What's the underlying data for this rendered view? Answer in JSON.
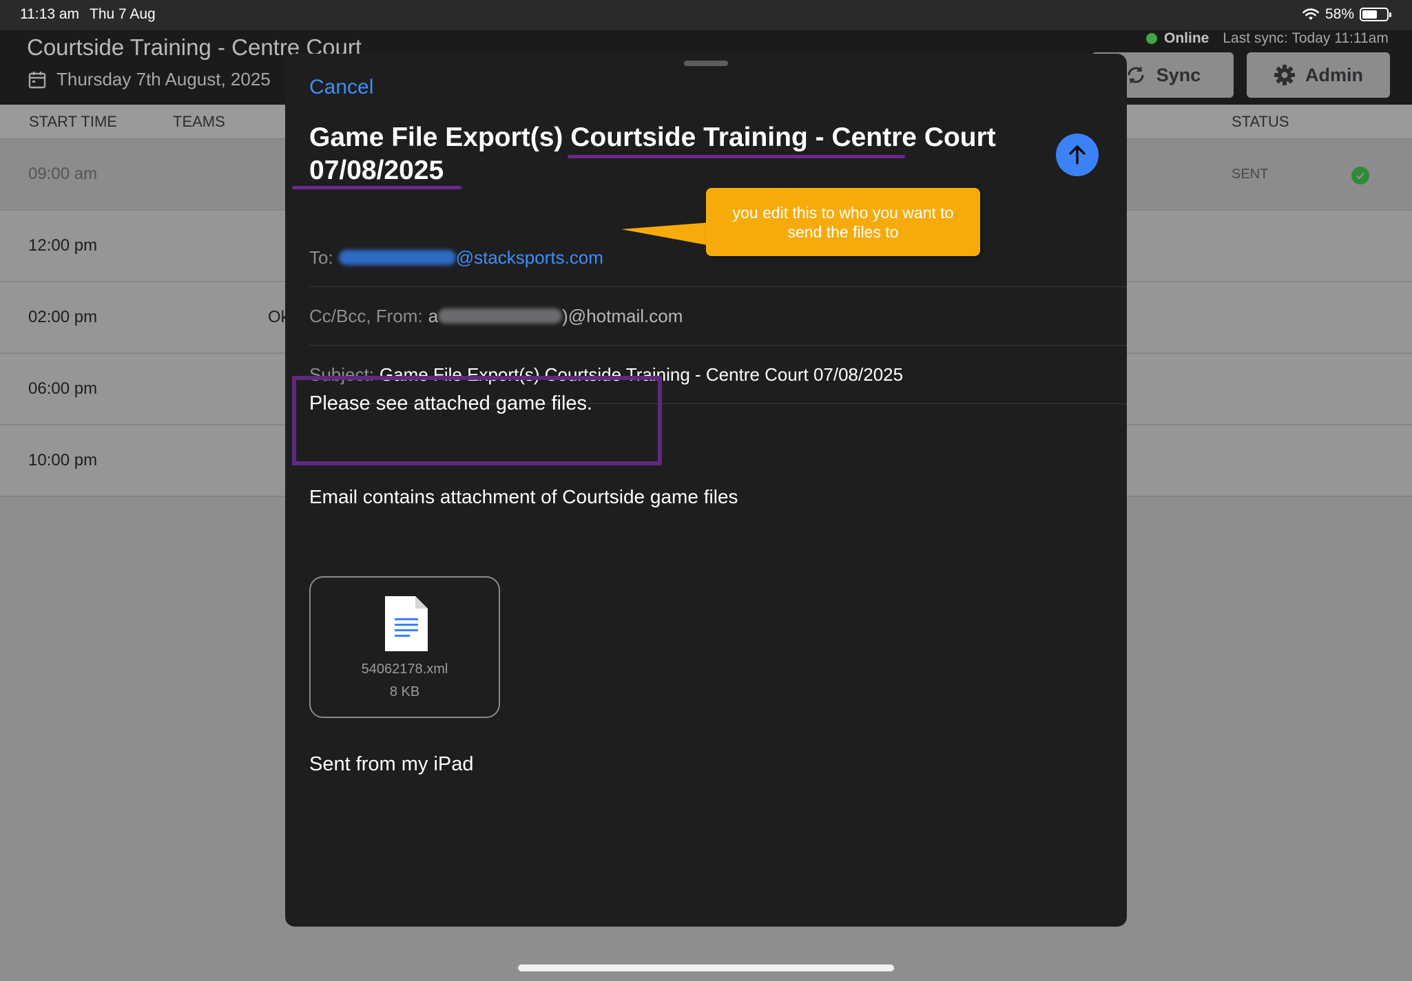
{
  "status_bar": {
    "time": "11:13 am",
    "date": "Thu 7 Aug",
    "battery": "58%"
  },
  "app": {
    "title": "Courtside Training - Centre Court",
    "date": "Thursday 7th August, 2025",
    "online_label": "Online",
    "last_sync": "Last sync: Today 11:11am",
    "sync_button": "Sync",
    "admin_button": "Admin"
  },
  "table": {
    "headers": [
      "START TIME",
      "TEAMS",
      "STATUS"
    ],
    "rows": [
      {
        "time": "09:00 am",
        "status": "SENT"
      },
      {
        "time": "12:00 pm"
      },
      {
        "time": "02:00 pm",
        "teams_partial": "Ok"
      },
      {
        "time": "06:00 pm"
      },
      {
        "time": "10:00 pm"
      }
    ]
  },
  "compose": {
    "cancel": "Cancel",
    "title_prefix": "Game File Export(s) ",
    "title_venue": "Courtside Training - Centre Court",
    "title_date": "07/08/2025",
    "to_label": "To:",
    "to_domain": "@stacksports.com",
    "cc_label": "Cc/Bcc, From:",
    "cc_initial": "a",
    "cc_domain": ")@hotmail.com",
    "subject_label": "Subject:",
    "subject_value": "Game File Export(s) Courtside Training - Centre Court  07/08/2025",
    "body": "Please see attached game files.",
    "attachment_note": "Email contains attachment of Courtside game files",
    "attachment": {
      "name": "54062178.xml",
      "size": "8 KB"
    },
    "signature": "Sent from my iPad"
  },
  "callout": {
    "text": "you edit this to who you want to send the files to"
  },
  "colors": {
    "accent_blue": "#3d8ef7",
    "send_blue": "#3b82f6",
    "highlight_purple": "#5e2a7e",
    "callout_orange": "#f6ab0b",
    "online_green": "#40a546"
  }
}
